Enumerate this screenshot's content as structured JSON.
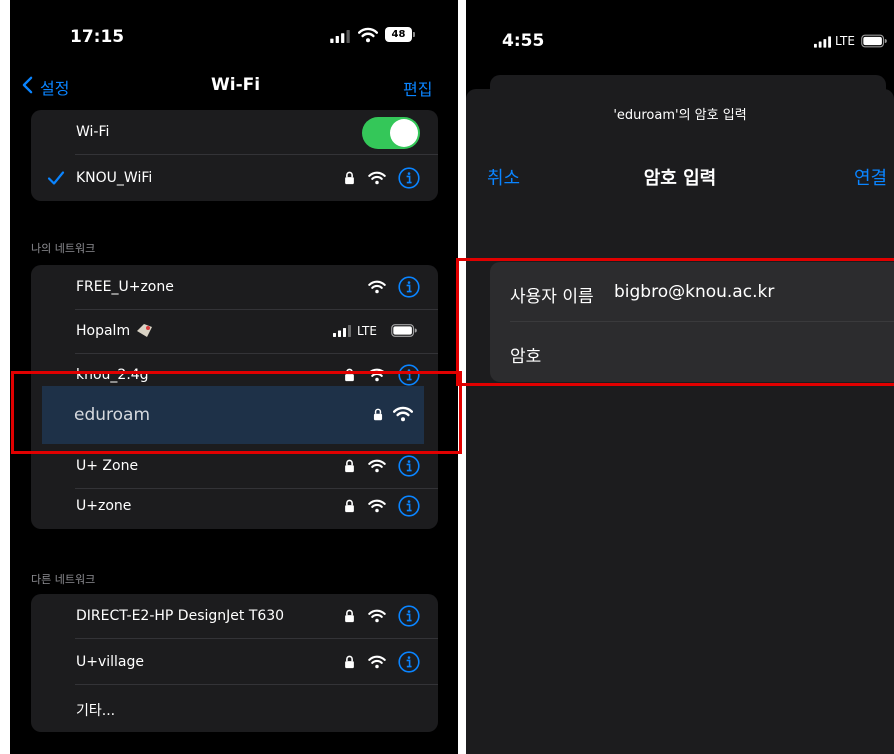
{
  "left": {
    "status": {
      "time": "17:15",
      "battery": "48"
    },
    "nav": {
      "back_label": "설정",
      "title": "Wi-Fi",
      "edit_label": "편집"
    },
    "wifi_toggle": {
      "label": "Wi-Fi",
      "on": true
    },
    "connected": {
      "name": "KNOU_WiFi"
    },
    "my_networks": {
      "header": "나의 네트워크",
      "items": [
        {
          "name": "FREE_U+zone"
        },
        {
          "name": "Hopalm"
        },
        {
          "name": "knou_2.4g"
        },
        {
          "name": "eduroam"
        },
        {
          "name": "U+ Zone"
        },
        {
          "name": "U+zone"
        }
      ]
    },
    "hotspot_cell_label": "LTE",
    "other_networks": {
      "header": "다른 네트워크",
      "items": [
        {
          "name": "DIRECT-E2-HP DesignJet T630"
        },
        {
          "name": "U+village"
        },
        {
          "name": "기타..."
        }
      ]
    }
  },
  "right": {
    "status": {
      "time": "4:55",
      "cell_label": "LTE"
    },
    "sheet": {
      "prompt": "'eduroam'의 암호 입력",
      "cancel_label": "취소",
      "title": "암호 입력",
      "connect_label": "연결"
    },
    "form": {
      "username_label": "사용자 이름",
      "username_value": "bigbro@knou.ac.kr",
      "password_label": "암호",
      "password_value": ""
    }
  },
  "colors": {
    "accent": "#0a84ff",
    "toggle_on": "#34c759",
    "highlight": "#e10000"
  }
}
